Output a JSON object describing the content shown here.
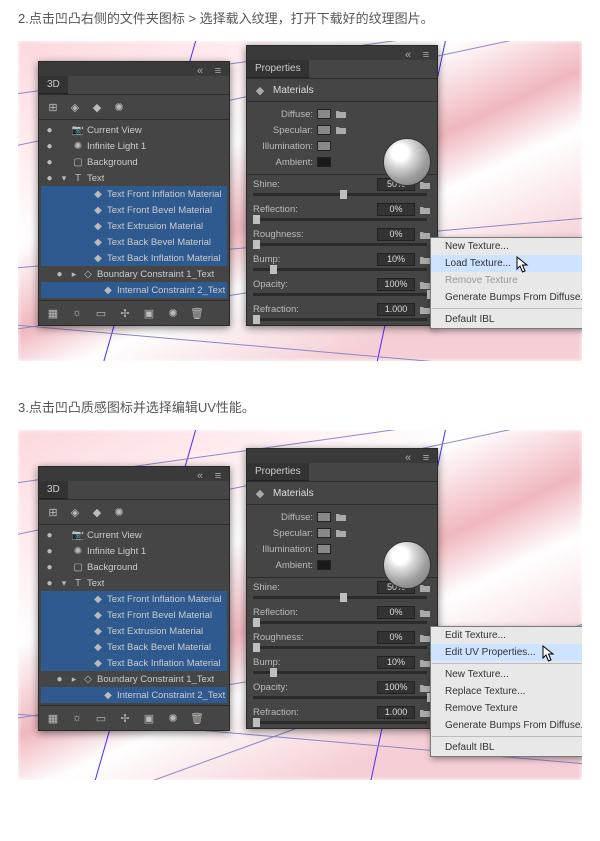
{
  "steps": {
    "s2": "2.点击凹凸右侧的文件夹图标 > 选择载入纹理，打开下载好的纹理图片。",
    "s3": "3.点击凹凸质感图标并选择编辑UV性能。"
  },
  "panel3d": {
    "tab": "3D",
    "tree": [
      {
        "eye": "●",
        "chev": "",
        "icon": "camera",
        "label": "Current View",
        "sel": false,
        "indent": 0
      },
      {
        "eye": "●",
        "chev": "",
        "icon": "light",
        "label": "Infinite Light 1",
        "sel": false,
        "indent": 0
      },
      {
        "eye": "●",
        "chev": "",
        "icon": "bg",
        "label": "Background",
        "sel": false,
        "indent": 0
      },
      {
        "eye": "●",
        "chev": "▾",
        "icon": "text",
        "label": "Text",
        "sel": false,
        "indent": 0
      },
      {
        "eye": "",
        "chev": "",
        "icon": "mat",
        "label": "Text Front Inflation Material",
        "sel": true,
        "indent": 2
      },
      {
        "eye": "",
        "chev": "",
        "icon": "mat",
        "label": "Text Front Bevel Material",
        "sel": true,
        "indent": 2
      },
      {
        "eye": "",
        "chev": "",
        "icon": "mat",
        "label": "Text Extrusion Material",
        "sel": true,
        "indent": 2
      },
      {
        "eye": "",
        "chev": "",
        "icon": "mat",
        "label": "Text Back Bevel Material",
        "sel": true,
        "indent": 2
      },
      {
        "eye": "",
        "chev": "",
        "icon": "mat",
        "label": "Text Back Inflation Material",
        "sel": true,
        "indent": 2
      },
      {
        "eye": "●",
        "chev": "▸",
        "icon": "mesh",
        "label": "Boundary Constraint 1_Text",
        "sel": false,
        "indent": 1
      },
      {
        "eye": "",
        "chev": "",
        "icon": "mat",
        "label": "Internal Constraint 2_Text",
        "sel": true,
        "indent": 3
      }
    ]
  },
  "props": {
    "tab": "Properties",
    "section": "Materials",
    "swatchrows": [
      {
        "label": "Diffuse:"
      },
      {
        "label": "Specular:"
      },
      {
        "label": "Illumination:"
      },
      {
        "label": "Ambient:"
      }
    ],
    "sliders": [
      {
        "label": "Shine:",
        "val": "50%",
        "knob": 50
      },
      {
        "label": "Reflection:",
        "val": "0%",
        "knob": 0
      },
      {
        "label": "Roughness:",
        "val": "0%",
        "knob": 0
      },
      {
        "label": "Bump:",
        "val": "10%",
        "knob": 10,
        "folder": true
      },
      {
        "label": "Opacity:",
        "val": "100%",
        "knob": 100
      },
      {
        "label": "Refraction:",
        "val": "1.000",
        "knob": 0
      }
    ]
  },
  "ctx1": {
    "items": [
      {
        "t": "New Texture...",
        "hi": false
      },
      {
        "t": "Load Texture...",
        "hi": true
      },
      {
        "t": "Remove Texture",
        "dis": true
      },
      {
        "t": "Generate Bumps From Diffuse...",
        "hi": false
      },
      {
        "sep": true
      },
      {
        "t": "Default IBL",
        "hi": false
      }
    ]
  },
  "ctx2": {
    "items": [
      {
        "t": "Edit Texture...",
        "hi": false
      },
      {
        "t": "Edit UV Properties...",
        "hi": true
      },
      {
        "sep": true
      },
      {
        "t": "New Texture...",
        "hi": false
      },
      {
        "t": "Replace Texture...",
        "hi": false
      },
      {
        "t": "Remove Texture",
        "hi": false
      },
      {
        "t": "Generate Bumps From Diffuse...",
        "hi": false
      },
      {
        "sep": true
      },
      {
        "t": "Default IBL",
        "hi": false
      }
    ]
  }
}
